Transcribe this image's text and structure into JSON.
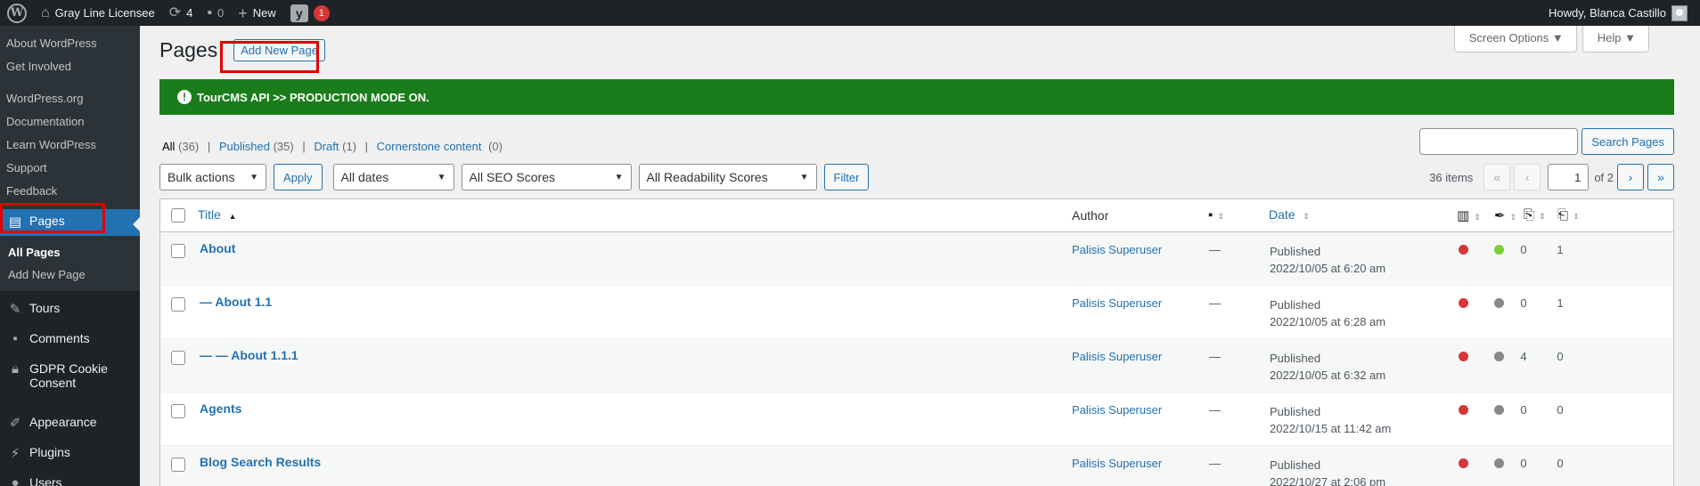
{
  "adminbar": {
    "site_name": "Gray Line Licensee",
    "updates_count": "4",
    "comments_count": "0",
    "new_label": "New",
    "yoast_count": "1",
    "howdy": "Howdy, Blanca Castillo"
  },
  "sidebar": {
    "wp_links": [
      "About WordPress",
      "Get Involved"
    ],
    "wp_links2": [
      "WordPress.org",
      "Documentation",
      "Learn WordPress",
      "Support",
      "Feedback"
    ],
    "pages_label": "Pages",
    "pages_sub": [
      "All Pages",
      "Add New Page"
    ],
    "tours_label": "Tours",
    "comments_label": "Comments",
    "gdpr_label": "GDPR Cookie Consent",
    "appearance_label": "Appearance",
    "plugins_label": "Plugins",
    "users_label": "Users"
  },
  "header": {
    "title": "Pages",
    "add_new": "Add New Page",
    "screen_options": "Screen Options ▼",
    "help": "Help ▼"
  },
  "notice": {
    "text": "TourCMS API >> PRODUCTION MODE ON."
  },
  "filters": {
    "all": "All",
    "all_count": "(36)",
    "published": "Published",
    "published_count": "(35)",
    "draft": "Draft",
    "draft_count": "(1)",
    "cornerstone": "Cornerstone content",
    "cornerstone_count": "(0)",
    "sep": "|"
  },
  "search": {
    "button": "Search Pages"
  },
  "tablenav": {
    "bulk_actions": "Bulk actions",
    "apply": "Apply",
    "dates": "All dates",
    "seo": "All SEO Scores",
    "readability": "All Readability Scores",
    "filter": "Filter",
    "items": "36 items",
    "first": "«",
    "prev": "‹",
    "current_page": "1",
    "of_pages": "of 2",
    "next": "›",
    "last": "»"
  },
  "table": {
    "headers": {
      "title": "Title",
      "author": "Author",
      "date": "Date"
    },
    "colors": {
      "red": "#d63638",
      "green": "#7ad03a",
      "gray": "#888888"
    },
    "rows": [
      {
        "title": "About",
        "author": "Palisis Superuser",
        "comments": "—",
        "status": "Published",
        "date": "2022/10/05 at 6:20 am",
        "seo": "red",
        "readability": "green",
        "links_out": "0",
        "links_in": "1"
      },
      {
        "title": "— About 1.1",
        "author": "Palisis Superuser",
        "comments": "—",
        "status": "Published",
        "date": "2022/10/05 at 6:28 am",
        "seo": "red",
        "readability": "gray",
        "links_out": "0",
        "links_in": "1"
      },
      {
        "title": "— — About 1.1.1",
        "author": "Palisis Superuser",
        "comments": "—",
        "status": "Published",
        "date": "2022/10/05 at 6:32 am",
        "seo": "red",
        "readability": "gray",
        "links_out": "4",
        "links_in": "0"
      },
      {
        "title": "Agents",
        "author": "Palisis Superuser",
        "comments": "—",
        "status": "Published",
        "date": "2022/10/15 at 11:42 am",
        "seo": "red",
        "readability": "gray",
        "links_out": "0",
        "links_in": "0"
      },
      {
        "title": "Blog Search Results",
        "author": "Palisis Superuser",
        "comments": "—",
        "status": "Published",
        "date": "2022/10/27 at 2:06 pm",
        "seo": "red",
        "readability": "gray",
        "links_out": "0",
        "links_in": "0"
      }
    ]
  }
}
